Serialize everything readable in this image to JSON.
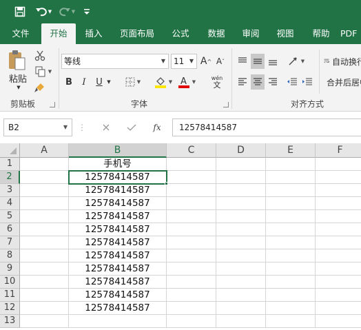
{
  "colors": {
    "brand": "#217346",
    "ribbon_bg": "#f3f3f3",
    "font_color_bar": "#e00000",
    "fill_color_bar": "#ffe600"
  },
  "qat": {
    "save_icon": "save-icon",
    "undo_icon": "undo-icon",
    "redo_icon": "redo-icon",
    "customize_icon": "customize-qat-icon"
  },
  "tabs": [
    {
      "label": "文件"
    },
    {
      "label": "开始"
    },
    {
      "label": "插入"
    },
    {
      "label": "页面布局"
    },
    {
      "label": "公式"
    },
    {
      "label": "数据"
    },
    {
      "label": "审阅"
    },
    {
      "label": "视图"
    },
    {
      "label": "帮助"
    },
    {
      "label": "PDF"
    }
  ],
  "active_tab": "开始",
  "ribbon": {
    "clipboard": {
      "paste_label": "粘贴",
      "group_label": "剪贴板"
    },
    "font": {
      "font_name": "等线",
      "font_size": "11",
      "group_label": "字体",
      "bold": "B",
      "italic": "I",
      "underline": "U",
      "phonetic": "wén"
    },
    "alignment": {
      "group_label": "对齐方式",
      "wrap_text": "自动换行",
      "merge_center": "合并后居中"
    }
  },
  "formula_bar": {
    "name_box": "B2",
    "formula": "12578414587",
    "fx": "fx"
  },
  "sheet": {
    "columns": [
      "A",
      "B",
      "C",
      "D",
      "E",
      "F"
    ],
    "selected_column": "B",
    "rows": [
      "1",
      "2",
      "3",
      "4",
      "5",
      "6",
      "7",
      "8",
      "9",
      "10",
      "11",
      "12",
      "13"
    ],
    "selected_row": "2",
    "header_cell": "手机号",
    "b_values": [
      "12578414587",
      "12578414587",
      "12578414587",
      "12578414587",
      "12578414587",
      "12578414587",
      "12578414587",
      "12578414587",
      "12578414587",
      "12578414587",
      "12578414587"
    ]
  }
}
